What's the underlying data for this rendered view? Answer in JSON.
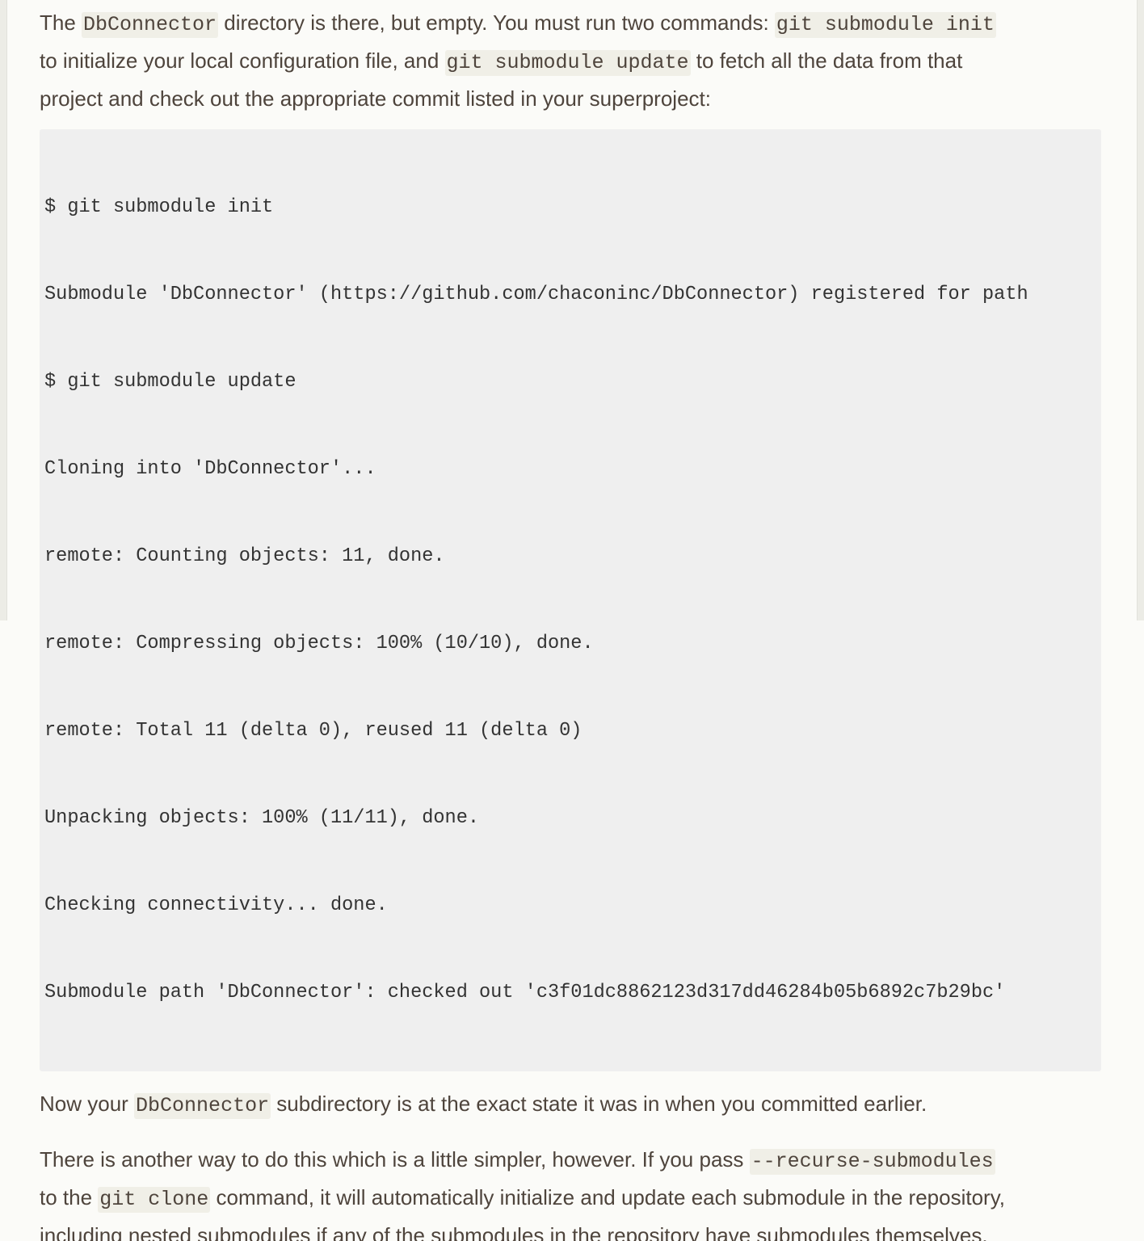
{
  "paragraph_1": {
    "line_1": {
      "t1": "The ",
      "c1": "DbConnector",
      "t2": " directory is there, but empty. You must run two commands: ",
      "c2": "git submodule init"
    },
    "line_2": {
      "t1": "to initialize your local configuration file, and ",
      "c1": "git submodule update",
      "t2": " to fetch all the data from that"
    },
    "line_3": {
      "t1": "project and check out the appropriate commit listed in your superproject:"
    }
  },
  "code_block": {
    "lines": [
      "$ git submodule init",
      "Submodule 'DbConnector' (https://github.com/chaconinc/DbConnector) registered for path",
      "$ git submodule update",
      "Cloning into 'DbConnector'...",
      "remote: Counting objects: 11, done.",
      "remote: Compressing objects: 100% (10/10), done.",
      "remote: Total 11 (delta 0), reused 11 (delta 0)",
      "Unpacking objects: 100% (11/11), done.",
      "Checking connectivity... done.",
      "Submodule path 'DbConnector': checked out 'c3f01dc8862123d317dd46284b05b6892c7b29bc'"
    ]
  },
  "paragraph_2": {
    "t1": "Now your ",
    "c1": "DbConnector",
    "t2": " subdirectory is at the exact state it was in when you committed earlier."
  },
  "paragraph_3": {
    "line_1": {
      "t1": "There is another way to do this which is a little simpler, however. If you pass ",
      "c1": "--recurse-submodules"
    },
    "line_2": {
      "t1": "to the ",
      "c1": "git clone",
      "t2": " command, it will automatically initialize and update each submodule in the repository,"
    },
    "line_3": {
      "t1": "including nested submodules if any of the submodules in the repository have submodules themselves."
    }
  }
}
